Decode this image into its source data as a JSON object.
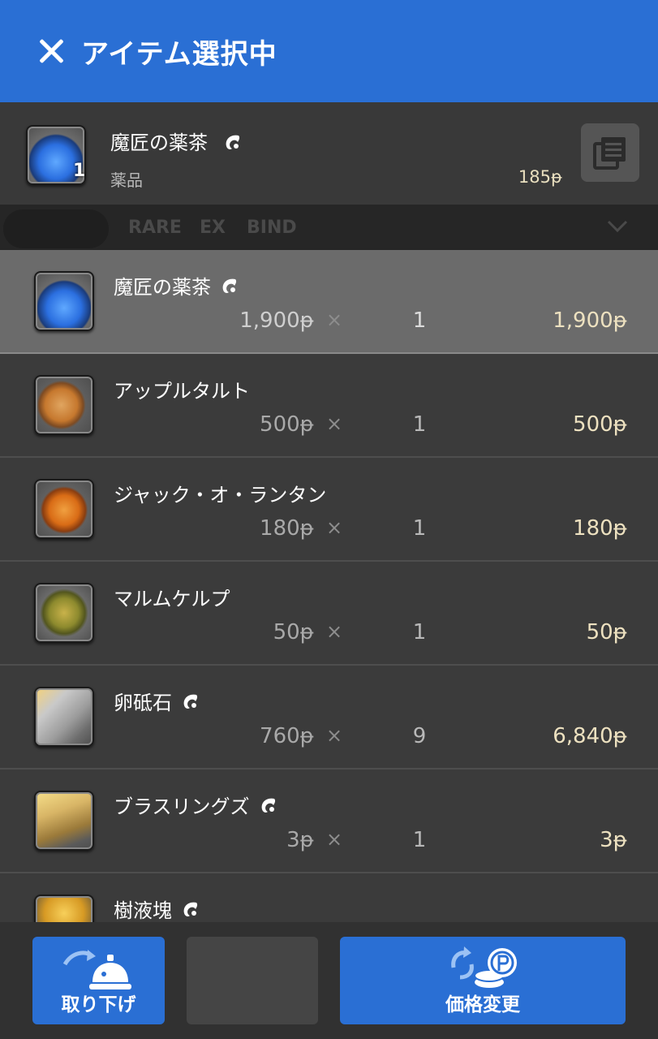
{
  "header": {
    "title": "アイテム選択中"
  },
  "selected_item": {
    "name": "魔匠の薬茶",
    "quantity": "1",
    "category": "薬品",
    "price": "185ᵽ"
  },
  "filter": {
    "tags": [
      "RARE",
      "EX",
      "BIND"
    ]
  },
  "items": [
    {
      "name": "魔匠の薬茶",
      "hq": true,
      "unit_price": "1,900ᵽ",
      "times": "×",
      "count": "1",
      "total": "1,900ᵽ",
      "icon": "tea-icon"
    },
    {
      "name": "アップルタルト",
      "hq": false,
      "unit_price": "500ᵽ",
      "times": "×",
      "count": "1",
      "total": "500ᵽ",
      "icon": "apple-tart-icon"
    },
    {
      "name": "ジャック・オ・ランタン",
      "hq": false,
      "unit_price": "180ᵽ",
      "times": "×",
      "count": "1",
      "total": "180ᵽ",
      "icon": "jack-o-lantern-icon"
    },
    {
      "name": "マルムケルプ",
      "hq": false,
      "unit_price": "50ᵽ",
      "times": "×",
      "count": "1",
      "total": "50ᵽ",
      "icon": "kelp-icon"
    },
    {
      "name": "卵砥石",
      "hq": true,
      "unit_price": "760ᵽ",
      "times": "×",
      "count": "9",
      "total": "6,840ᵽ",
      "icon": "whetstone-icon"
    },
    {
      "name": "ブラスリングズ",
      "hq": true,
      "unit_price": "3ᵽ",
      "times": "×",
      "count": "1",
      "total": "3ᵽ",
      "icon": "brass-rings-icon"
    },
    {
      "name": "樹液塊",
      "hq": true,
      "unit_price": "",
      "times": "",
      "count": "",
      "total": "",
      "icon": "sap-icon"
    }
  ],
  "footer": {
    "withdraw_label": "取り下げ",
    "price_change_label": "価格変更"
  },
  "colors": {
    "header_blue": "#2a6fd4",
    "price_gold": "#ede1c0"
  }
}
